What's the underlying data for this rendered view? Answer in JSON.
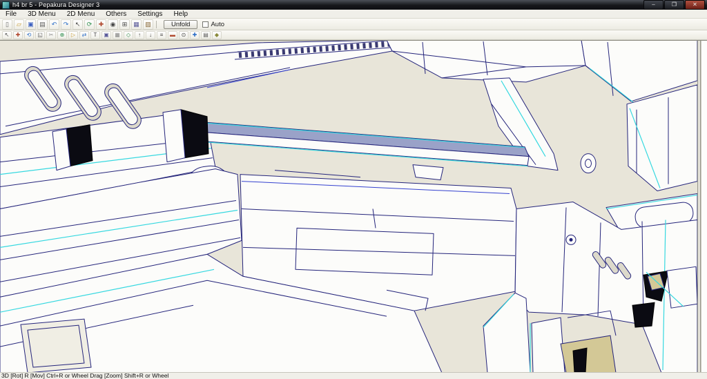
{
  "window": {
    "title": "h4 br 5 - Pepakura Designer 3",
    "controls": {
      "minimize": "–",
      "maximize": "❐",
      "close": "✕"
    }
  },
  "menu": {
    "items": [
      "File",
      "3D Menu",
      "2D Menu",
      "Others",
      "Settings",
      "Help"
    ]
  },
  "toolbar_top": {
    "unfold_label": "Unfold",
    "auto_label": "Auto",
    "auto_checked": false,
    "icons": [
      {
        "name": "new-file",
        "glyph": "▯",
        "color": "#6a6a6a"
      },
      {
        "name": "open-folder",
        "glyph": "▱",
        "color": "#c79a2e"
      },
      {
        "name": "save",
        "glyph": "▣",
        "color": "#3a5fbf"
      },
      {
        "name": "print",
        "glyph": "▤",
        "color": "#5a5a5a"
      },
      {
        "name": "undo",
        "glyph": "↶",
        "color": "#2e6fc7"
      },
      {
        "name": "redo",
        "glyph": "↷",
        "color": "#2e6fc7"
      },
      {
        "name": "select-mode",
        "glyph": "↖",
        "color": "#444444"
      },
      {
        "name": "rotate-view",
        "glyph": "⟳",
        "color": "#2e8f4e"
      },
      {
        "name": "pan-view",
        "glyph": "✚",
        "color": "#b0482e"
      },
      {
        "name": "zoom-view",
        "glyph": "◉",
        "color": "#444444"
      },
      {
        "name": "fit-view",
        "glyph": "⊞",
        "color": "#444444"
      },
      {
        "name": "wireframe-toggle",
        "glyph": "▦",
        "color": "#5a5a9a"
      },
      {
        "name": "texture-toggle",
        "glyph": "▨",
        "color": "#8a6a3a"
      }
    ]
  },
  "toolbar_second": {
    "icons": [
      {
        "name": "edit-select",
        "glyph": "↖",
        "color": "#444444"
      },
      {
        "name": "move-part",
        "glyph": "✚",
        "color": "#b0482e"
      },
      {
        "name": "rotate-part",
        "glyph": "⟲",
        "color": "#2e6fc7"
      },
      {
        "name": "scale-part",
        "glyph": "◱",
        "color": "#444444"
      },
      {
        "name": "divide-edge",
        "glyph": "✂",
        "color": "#8a8a8a"
      },
      {
        "name": "join-edge",
        "glyph": "⊕",
        "color": "#2e8f4e"
      },
      {
        "name": "flap-edit",
        "glyph": "▷",
        "color": "#c79a2e"
      },
      {
        "name": "flap-flip",
        "glyph": "⇄",
        "color": "#2e6fc7"
      },
      {
        "name": "add-text",
        "glyph": "T",
        "color": "#444444"
      },
      {
        "name": "add-image",
        "glyph": "▣",
        "color": "#5a5a9a"
      },
      {
        "name": "grid-toggle",
        "glyph": "▦",
        "color": "#8a8a8a"
      },
      {
        "name": "snap-toggle",
        "glyph": "◇",
        "color": "#2e8f4e"
      },
      {
        "name": "bring-front",
        "glyph": "↑",
        "color": "#444444"
      },
      {
        "name": "send-back",
        "glyph": "↓",
        "color": "#444444"
      },
      {
        "name": "align-parts",
        "glyph": "≡",
        "color": "#444444"
      },
      {
        "name": "edge-color",
        "glyph": "▬",
        "color": "#b0482e"
      },
      {
        "name": "zoom-2d",
        "glyph": "⊙",
        "color": "#444444"
      },
      {
        "name": "pan-2d",
        "glyph": "✚",
        "color": "#2e6fc7"
      },
      {
        "name": "print-preview",
        "glyph": "▤",
        "color": "#5a5a5a"
      },
      {
        "name": "lock-part",
        "glyph": "◆",
        "color": "#8a8a3a"
      }
    ]
  },
  "viewport": {
    "colors": {
      "background": "#e8e5d9",
      "wireframe": "#23237a",
      "accent_cyan": "#35d8e0",
      "accent_blue": "#3340cf",
      "face_white": "#fcfcfa",
      "face_slate": "#9aa2c8",
      "face_tan": "#d3c896"
    }
  },
  "status_bar": {
    "text": "3D [Rot] R [Mov] Ctrl+R or Wheel Drag [Zoom] Shift+R or Wheel"
  }
}
